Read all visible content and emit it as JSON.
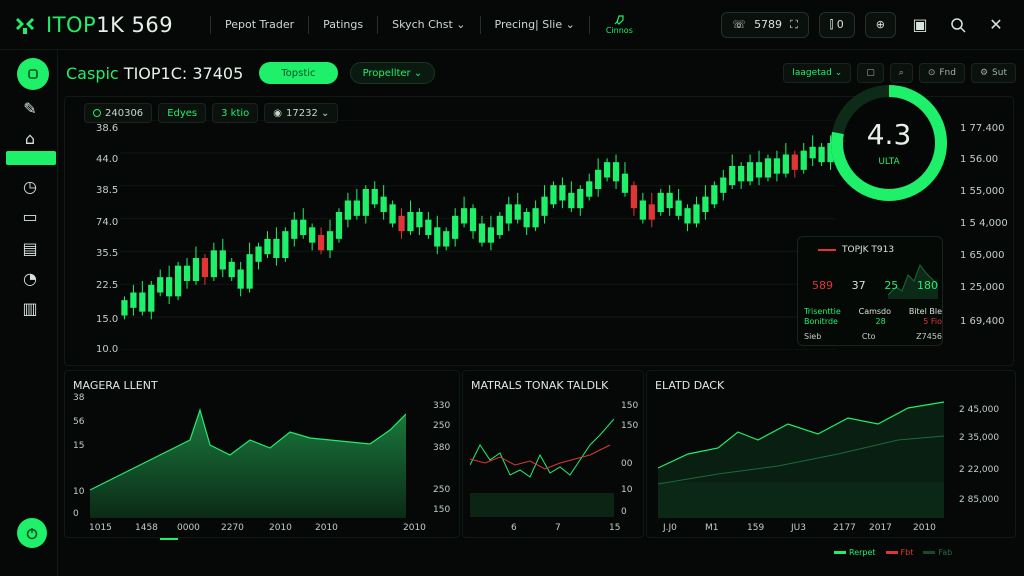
{
  "brand": {
    "title_a": "ITOP",
    "title_b": "1K 569"
  },
  "nav": [
    {
      "label": "Pepot Trader"
    },
    {
      "label": "Patings"
    },
    {
      "label": "Skych Chst ⌄"
    },
    {
      "label": "Precing| Slie ⌄"
    }
  ],
  "nav_extra": "Cinnos",
  "topbar_right": {
    "phone_value": "5789"
  },
  "topbar_pill2": "⫿ 0",
  "header": {
    "pair_label": "Caspic ",
    "pair_value": "TIOP1C: 37405",
    "green_button": "Topstic",
    "dark_button": "Propellter ⌄",
    "right_buttons": [
      "Iaagetad ⌄",
      "Fnd",
      "Sut"
    ]
  },
  "chips": [
    "240306",
    "Edyes",
    "3 ktio",
    "17232 ⌄"
  ],
  "left_axis": [
    "38.6",
    "44.0",
    "38.5",
    "74.0",
    "35.5",
    "22.5",
    "15.0",
    "10.0"
  ],
  "right_axis": [
    "1 77.400",
    "1 56.00",
    "1 55,000",
    "1 5 4,000",
    "1 65,000",
    "1 25,000",
    "1 69,400"
  ],
  "gauge": {
    "value": "4.3",
    "sub": "ULTA",
    "fraction": 0.78
  },
  "info_card": {
    "title": "TOPJK T913",
    "nums": [
      "589",
      "37",
      "25",
      "180"
    ],
    "sub_a": [
      "Trisenttie",
      "Camsdo",
      "Bitel Ble"
    ],
    "sub_b": [
      "Bonitrde",
      "28",
      "5 Fio"
    ],
    "footer": [
      "Sieb",
      "Cto",
      "Z7456"
    ]
  },
  "panels": [
    {
      "title": "MAGERA LLENT",
      "y_left": [
        "38",
        "56",
        "15",
        "10",
        "0"
      ],
      "y_right": [
        "330",
        "250",
        "380",
        "250",
        "150"
      ],
      "x": [
        "1015",
        "1458",
        "0000",
        "2270",
        "2010",
        "2010",
        "2010"
      ]
    },
    {
      "title": "MATRALS TONAK TALDLK",
      "y_right": [
        "150",
        "150",
        "00",
        "10",
        "0"
      ],
      "x": [
        "6",
        "7",
        "15"
      ]
    },
    {
      "title": "ELATD DACK",
      "y_right": [
        "2 45,000",
        "2 35,000",
        "2 22,000",
        "2 85,000"
      ],
      "x": [
        "J.J0",
        "M1",
        "159",
        "JU3",
        "2177",
        "2017",
        "2010"
      ]
    }
  ],
  "legend": [
    {
      "label": "Rerpet",
      "color": "#1ff06a"
    },
    {
      "label": "Fbt",
      "color": "#e03535"
    },
    {
      "label": "Fab",
      "color": "#1a4a2c"
    }
  ],
  "colors": {
    "accent": "#1ff06a",
    "down": "#e03535",
    "bg": "#050807"
  },
  "chart_data": {
    "type": "candlestick",
    "series_closes": [
      22,
      24,
      21,
      26,
      28,
      25,
      31,
      29,
      33,
      30,
      35,
      32,
      30,
      27,
      34,
      36,
      38,
      35,
      40,
      43,
      41,
      39,
      37,
      40,
      45,
      48,
      46,
      51,
      49,
      47,
      44,
      42,
      45,
      43,
      41,
      38,
      40,
      44,
      46,
      42,
      39,
      41,
      44,
      47,
      45,
      43,
      46,
      49,
      52,
      50,
      48,
      51,
      53,
      56,
      58,
      55,
      52,
      48,
      45,
      47,
      50,
      48,
      46,
      44,
      47,
      49,
      52,
      54,
      57,
      55,
      58,
      56,
      59,
      57,
      60,
      58,
      61,
      62,
      60,
      63
    ],
    "down_indices": [
      9,
      22,
      31,
      57,
      59,
      75,
      88
    ]
  }
}
